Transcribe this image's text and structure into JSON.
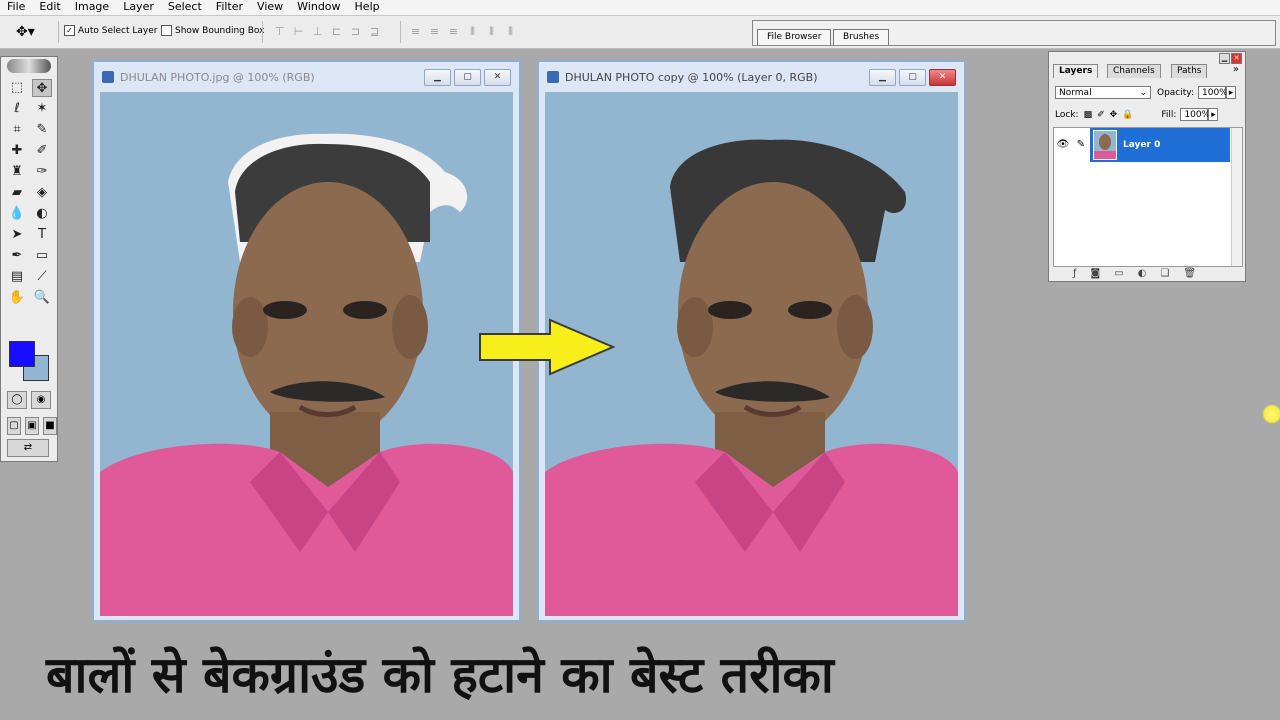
{
  "menu": [
    "File",
    "Edit",
    "Image",
    "Layer",
    "Select",
    "Filter",
    "View",
    "Window",
    "Help"
  ],
  "options": {
    "auto_select_label": "Auto Select Layer",
    "auto_select_checked": true,
    "show_bbox_label": "Show Bounding Box",
    "show_bbox_checked": false
  },
  "palette_well": {
    "tabs": [
      "File Browser",
      "Brushes"
    ]
  },
  "documents": {
    "left": {
      "title": "DHULAN PHOTO.jpg @ 100% (RGB)"
    },
    "right": {
      "title": "DHULAN PHOTO copy @ 100% (Layer 0, RGB)"
    }
  },
  "colors": {
    "foreground": "#1a0dff",
    "background": "#92b6d2",
    "arrow": "#f7ee1a",
    "canvas_bg": "#92b6d0",
    "shirt": "#e05a9a"
  },
  "layers_panel": {
    "tabs": [
      "Layers",
      "Channels",
      "Paths"
    ],
    "active_tab": "Layers",
    "blend_mode": "Normal",
    "opacity_label": "Opacity:",
    "opacity_value": "100%",
    "lock_label": "Lock:",
    "fill_label": "Fill:",
    "fill_value": "100%",
    "layers": [
      {
        "name": "Layer 0",
        "visible": true,
        "selected": true
      }
    ]
  },
  "caption": "बालों से बेकग्राउंड को हटाने का बेस्ट तरीका"
}
